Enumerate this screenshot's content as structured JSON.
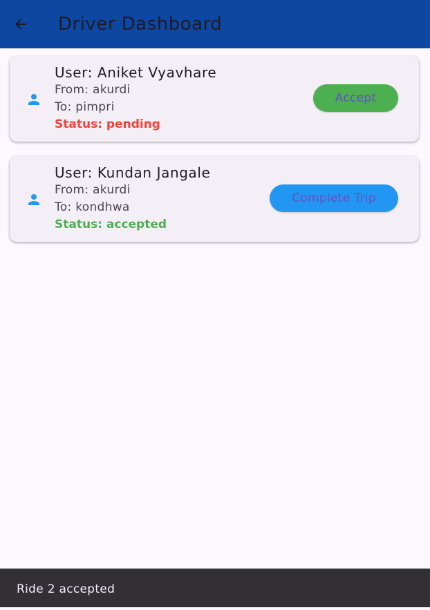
{
  "app_bar": {
    "title": "Driver Dashboard",
    "back_icon": "arrow-back-icon",
    "color": "#0d47a1"
  },
  "rides": [
    {
      "icon": "person-icon",
      "user": "User: Aniket Vyavhare",
      "from": "From: akurdi",
      "to": "To: pimpri",
      "status": "Status: pending",
      "status_color": "#f44336",
      "action_label": "Accept",
      "action_color": "#4caf50"
    },
    {
      "icon": "person-icon",
      "user": "User: Kundan Jangale",
      "from": "From: akurdi",
      "to": "To: kondhwa",
      "status": "Status: accepted",
      "status_color": "#4caf50",
      "action_label": "Complete Trip",
      "action_color": "#2196f3"
    }
  ],
  "snackbar": {
    "message": "Ride 2 accepted"
  }
}
